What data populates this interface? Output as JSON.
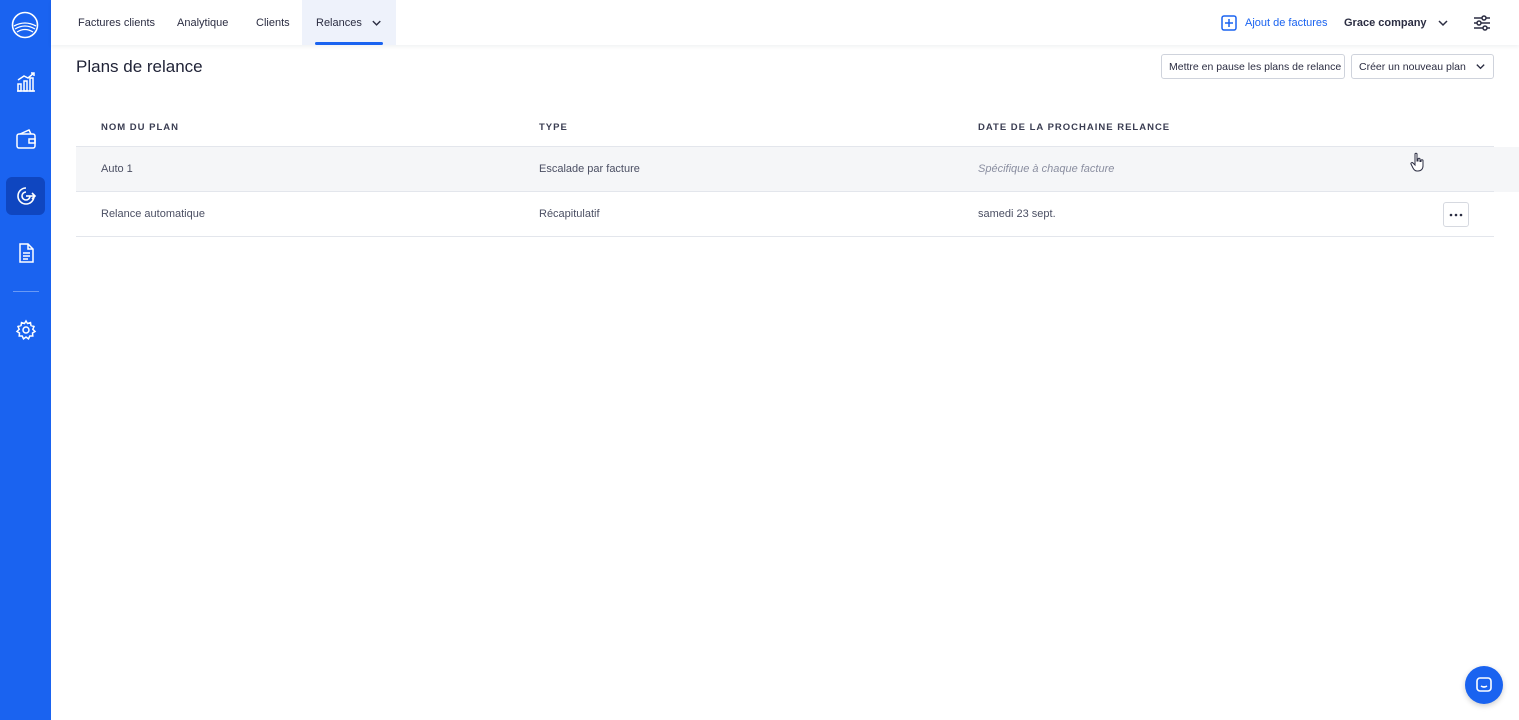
{
  "sidebar": {
    "items": [
      {
        "icon": "analytics-chart-icon"
      },
      {
        "icon": "wallet-icon"
      },
      {
        "icon": "reminder-icon"
      },
      {
        "icon": "document-icon"
      },
      {
        "icon": "settings-gear-icon"
      }
    ],
    "active_index": 2,
    "colors": {
      "background": "#1a63f0",
      "active": "#0f46c0"
    }
  },
  "nav": {
    "tabs": [
      {
        "label": "Factures clients"
      },
      {
        "label": "Analytique"
      },
      {
        "label": "Clients"
      },
      {
        "label": "Relances"
      }
    ],
    "active_tab": "Relances",
    "add_invoices_label": "Ajout de factures",
    "company_label": "Grace company"
  },
  "page": {
    "title": "Plans de relance",
    "pause_button_label": "Mettre en pause les plans de relance",
    "create_button_label": "Créer un nouveau plan"
  },
  "table": {
    "headers": [
      "NOM DU PLAN",
      "TYPE",
      "DATE DE LA PROCHAINE RELANCE"
    ],
    "rows": [
      {
        "name": "Auto 1",
        "type": "Escalade par facture",
        "next_date": "Spécifique à chaque facture",
        "next_date_italic": true
      },
      {
        "name": "Relance automatique",
        "type": "Récapitulatif",
        "next_date": "samedi 23 sept.",
        "next_date_italic": false
      }
    ]
  },
  "accent_color": "#1a63f0"
}
